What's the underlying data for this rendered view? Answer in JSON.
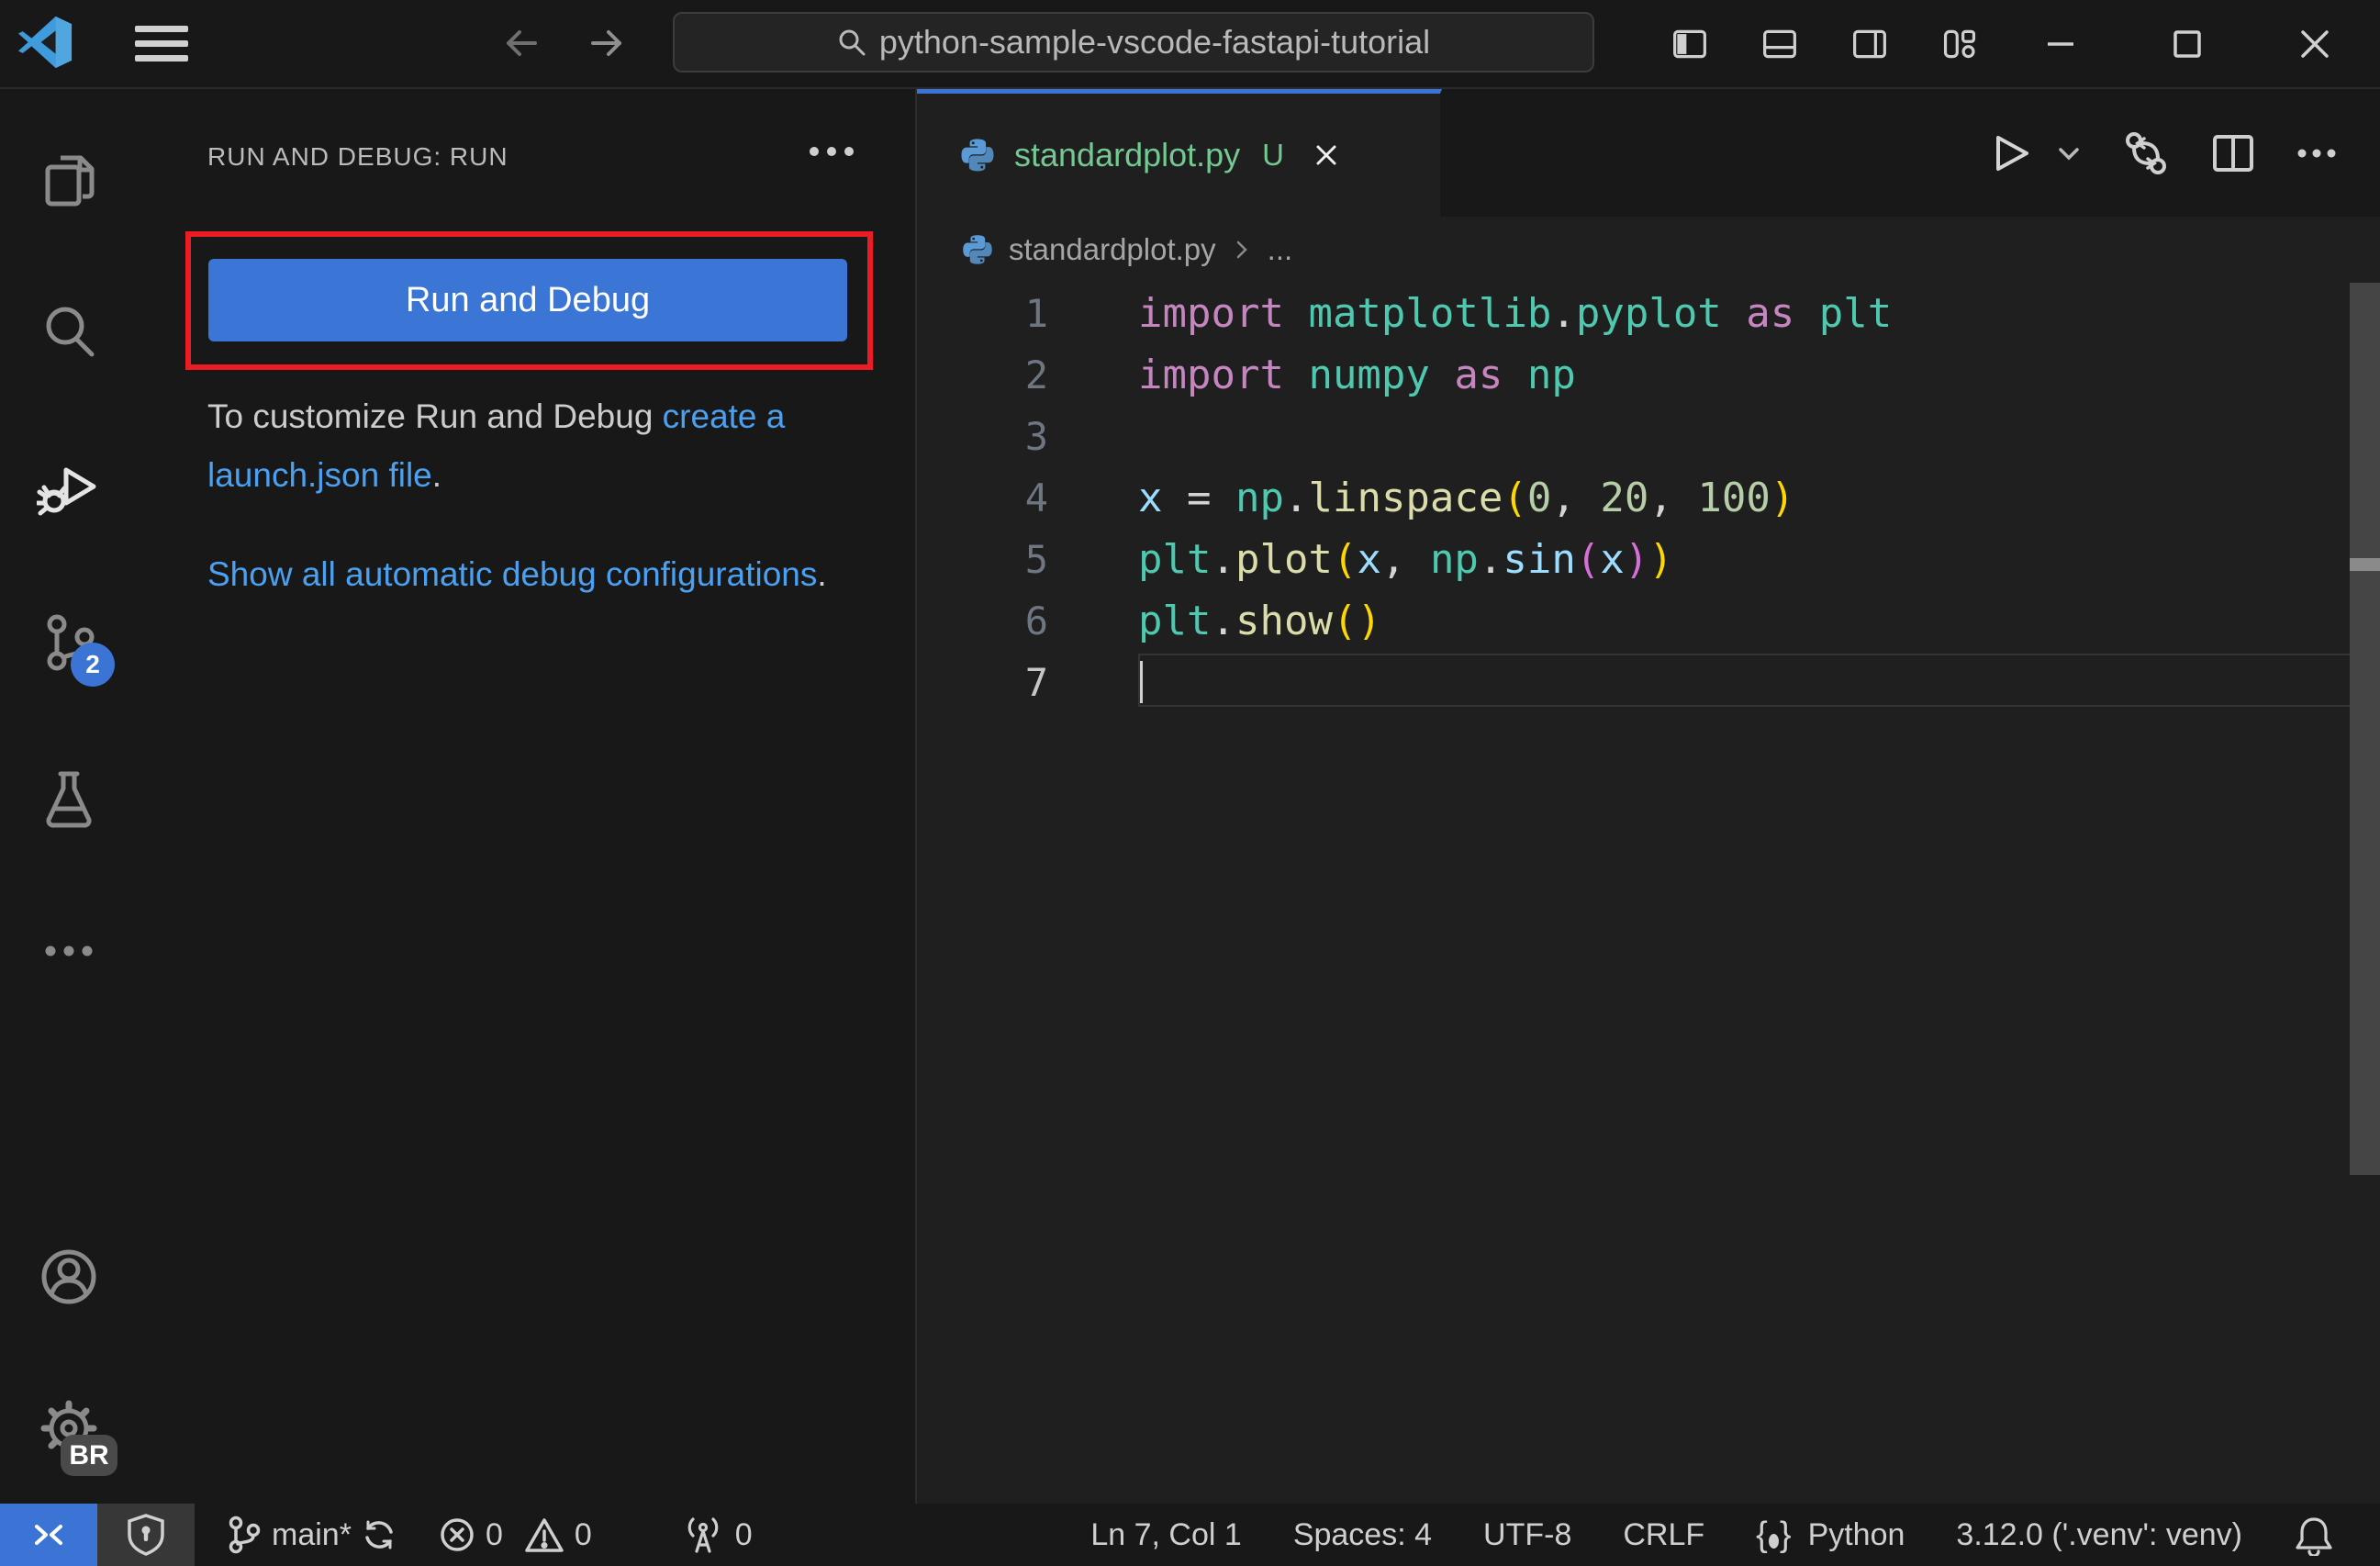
{
  "titlebar": {
    "search_value": "python-sample-vscode-fastapi-tutorial"
  },
  "activity_bar": {
    "source_control_badge": "2",
    "settings_badge": "BR"
  },
  "sidebar": {
    "header": "RUN AND DEBUG: RUN",
    "run_button": "Run and Debug",
    "hint_text": "To customize Run and Debug ",
    "hint_link": "create a launch.json file",
    "hint_suffix": ".",
    "auto_link": "Show all automatic debug configurations",
    "auto_suffix": "."
  },
  "editor": {
    "tab": {
      "label": "standardplot.py",
      "badge": "U"
    },
    "breadcrumb": {
      "file": "standardplot.py",
      "symbol": "..."
    },
    "code": {
      "lines": [
        {
          "num": "1",
          "tokens": [
            [
              "kw",
              "import"
            ],
            [
              "pln",
              " "
            ],
            [
              "ns",
              "matplotlib"
            ],
            [
              "pln",
              "."
            ],
            [
              "ns",
              "pyplot"
            ],
            [
              "kw",
              " as "
            ],
            [
              "ns",
              "plt"
            ]
          ]
        },
        {
          "num": "2",
          "tokens": [
            [
              "kw",
              "import"
            ],
            [
              "pln",
              " "
            ],
            [
              "ns",
              "numpy"
            ],
            [
              "kw",
              " as "
            ],
            [
              "ns",
              "np"
            ]
          ]
        },
        {
          "num": "3",
          "tokens": []
        },
        {
          "num": "4",
          "tokens": [
            [
              "var",
              "x"
            ],
            [
              "pln",
              " = "
            ],
            [
              "ns",
              "np"
            ],
            [
              "pln",
              "."
            ],
            [
              "fn",
              "linspace"
            ],
            [
              "b1",
              "("
            ],
            [
              "num",
              "0"
            ],
            [
              "pln",
              ", "
            ],
            [
              "num",
              "20"
            ],
            [
              "pln",
              ", "
            ],
            [
              "num",
              "100"
            ],
            [
              "b1",
              ")"
            ]
          ]
        },
        {
          "num": "5",
          "tokens": [
            [
              "ns",
              "plt"
            ],
            [
              "pln",
              "."
            ],
            [
              "fn",
              "plot"
            ],
            [
              "b1",
              "("
            ],
            [
              "var",
              "x"
            ],
            [
              "pln",
              ", "
            ],
            [
              "ns",
              "np"
            ],
            [
              "pln",
              "."
            ],
            [
              "var",
              "sin"
            ],
            [
              "b2",
              "("
            ],
            [
              "var",
              "x"
            ],
            [
              "b2",
              ")"
            ],
            [
              "b1",
              ")"
            ]
          ]
        },
        {
          "num": "6",
          "tokens": [
            [
              "ns",
              "plt"
            ],
            [
              "pln",
              "."
            ],
            [
              "fn",
              "show"
            ],
            [
              "b1",
              "("
            ],
            [
              "b1",
              ")"
            ]
          ]
        },
        {
          "num": "7",
          "tokens": [],
          "active": true
        }
      ]
    }
  },
  "status_bar": {
    "branch": "main*",
    "errors": "0",
    "warnings": "0",
    "ports": "0",
    "line_col": "Ln 7, Col 1",
    "indent": "Spaces: 4",
    "encoding": "UTF-8",
    "eol": "CRLF",
    "language": "Python",
    "interpreter": "3.12.0 ('.venv': venv)"
  },
  "colors": {
    "accent_blue": "#3b74d4",
    "link_blue": "#4ba0f0",
    "annotation_red": "#ec1c24",
    "untracked_green": "#73c991",
    "editor_bg": "#1f1f1f",
    "shell_bg": "#181818"
  }
}
